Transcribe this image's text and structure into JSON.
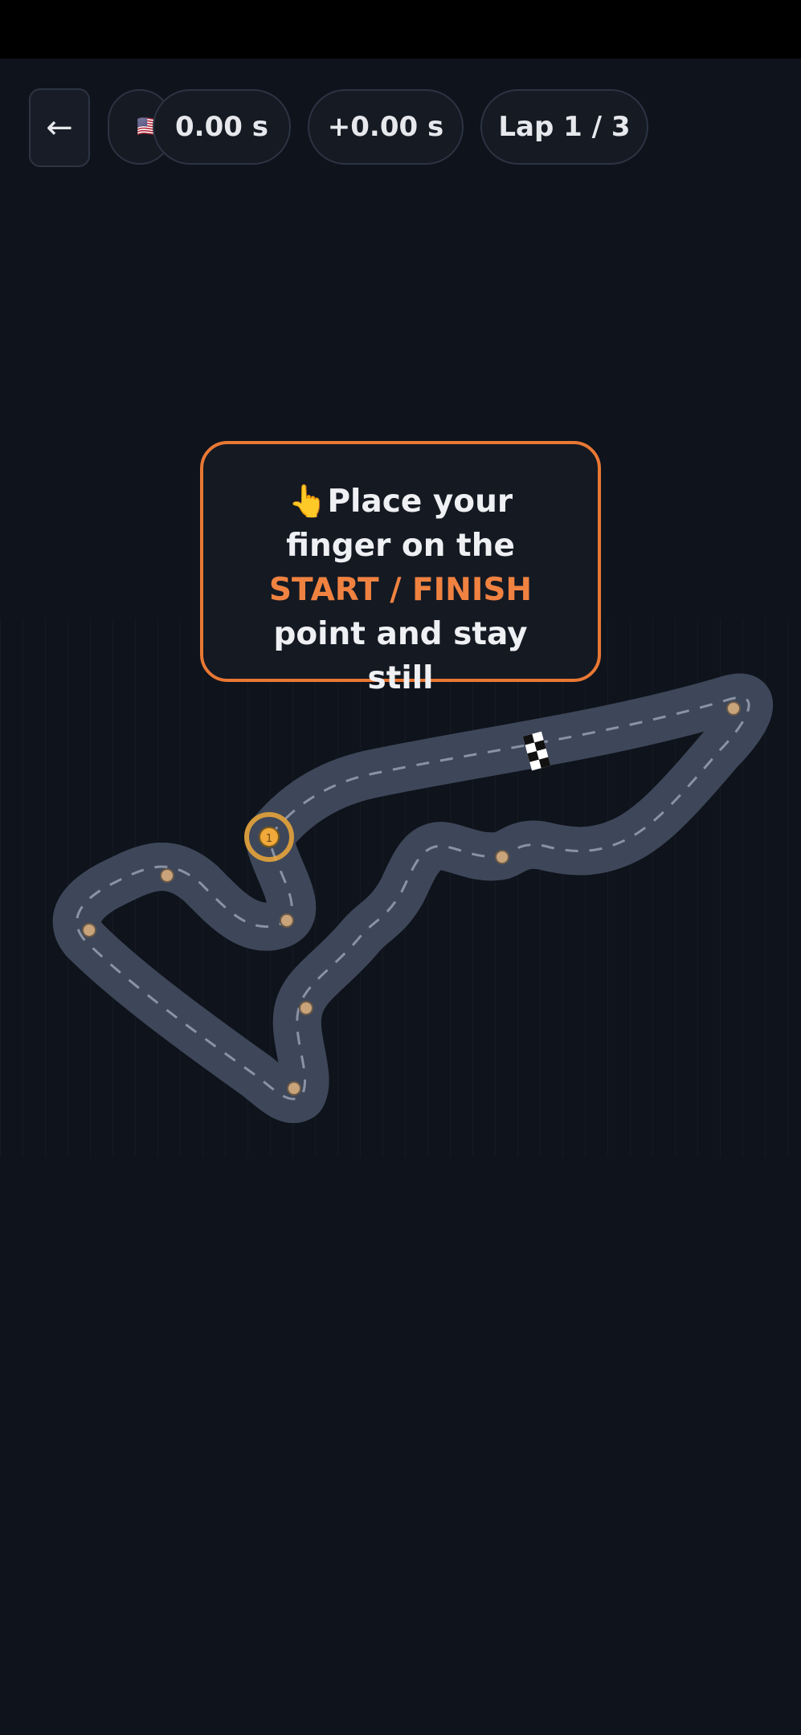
{
  "header": {
    "back_label": "←",
    "flag": "🇺🇸",
    "time": "0.00 s",
    "delta": "+0.00 s",
    "lap": "Lap 1 / 3"
  },
  "instruction": {
    "icon": "👆",
    "text_before": "Place your finger on the ",
    "highlight": "START / FINISH",
    "text_after": " point and stay still"
  },
  "track": {
    "start_marker_label": "1",
    "colors": {
      "track_fill": "#d3d8e1",
      "track_border": "#3d4759",
      "marker": "#c9a37a",
      "start_ring": "#f0a93a",
      "accent": "#f08241"
    }
  }
}
